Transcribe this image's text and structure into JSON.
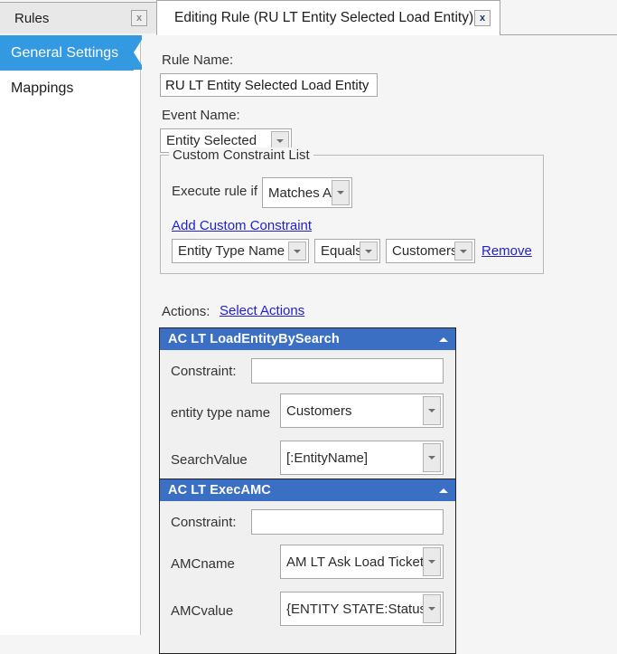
{
  "tabs": [
    {
      "label": "Rules",
      "close": "x",
      "active": false
    },
    {
      "label": "Editing Rule (RU LT Entity Selected Load Entity)",
      "close": "x",
      "active": true
    }
  ],
  "sidebar": {
    "items": [
      {
        "label": "General Settings",
        "selected": true
      },
      {
        "label": "Mappings",
        "selected": false
      }
    ]
  },
  "form": {
    "rule_name_label": "Rule Name:",
    "rule_name_value": "RU LT Entity Selected Load Entity",
    "event_name_label": "Event Name:",
    "event_name_value": "Entity Selected",
    "constraint_group": {
      "title": "Custom Constraint List",
      "execute_label": "Execute rule if",
      "execute_value": "Matches All",
      "add_link": "Add Custom Constraint",
      "rows": [
        {
          "field": "Entity Type Name",
          "operator": "Equals",
          "value": "Customers",
          "remove_link": "Remove"
        }
      ]
    },
    "actions_label": "Actions:",
    "select_actions_link": "Select Actions"
  },
  "action_panels": [
    {
      "title": "AC LT LoadEntityBySearch",
      "collapse_icon": "triangle-up",
      "constraint_label": "Constraint:",
      "constraint_value": "",
      "props": [
        {
          "label": "entity type name",
          "value": "Customers"
        },
        {
          "label": "SearchValue",
          "value": "[:EntityName]"
        }
      ]
    },
    {
      "title": "AC LT ExecAMC",
      "collapse_icon": "triangle-up",
      "constraint_label": "Constraint:",
      "constraint_value": "",
      "props": [
        {
          "label": "AMCname",
          "value": "AM LT Ask Load Ticket"
        },
        {
          "label": "AMCvalue",
          "value": "{ENTITY STATE:Status}"
        }
      ]
    }
  ],
  "colors": {
    "accent_blue": "#3399e0",
    "panel_header_blue": "#3a6fc4",
    "link_blue": "#2222cc",
    "background": "#f5f5f5"
  }
}
